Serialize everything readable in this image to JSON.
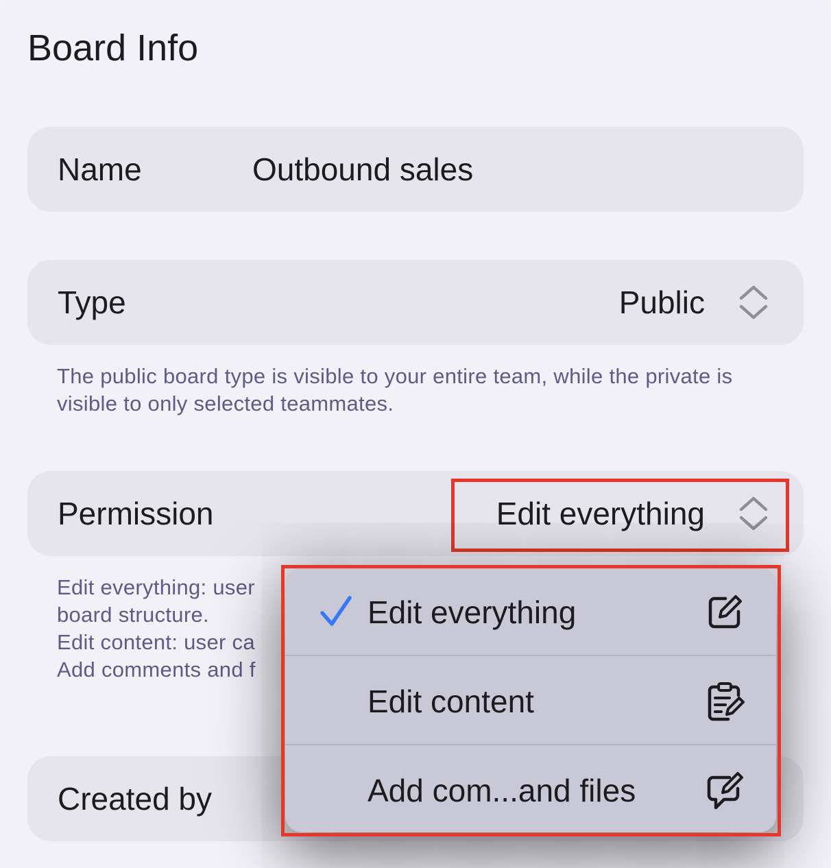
{
  "page": {
    "title": "Board Info"
  },
  "name_row": {
    "label": "Name",
    "value": "Outbound sales"
  },
  "type_row": {
    "label": "Type",
    "value": "Public",
    "help": "The public board type is visible to your entire team, while the private is visible to only selected teammates."
  },
  "permission_row": {
    "label": "Permission",
    "value": "Edit everything",
    "help_lines": [
      "Edit everything: user",
      "board structure.",
      "Edit content: user ca",
      "Add comments and f"
    ]
  },
  "created_row": {
    "label": "Created by"
  },
  "permission_menu": {
    "items": [
      {
        "label": "Edit everything",
        "selected": true,
        "icon": "square-pencil-icon"
      },
      {
        "label": "Edit content",
        "selected": false,
        "icon": "clipboard-edit-icon"
      },
      {
        "label": "Add com...and files",
        "selected": false,
        "icon": "message-edit-icon"
      }
    ]
  },
  "colors": {
    "accent_check": "#3478f6",
    "highlight": "#e5382a",
    "help_text": "#5e5c86"
  }
}
